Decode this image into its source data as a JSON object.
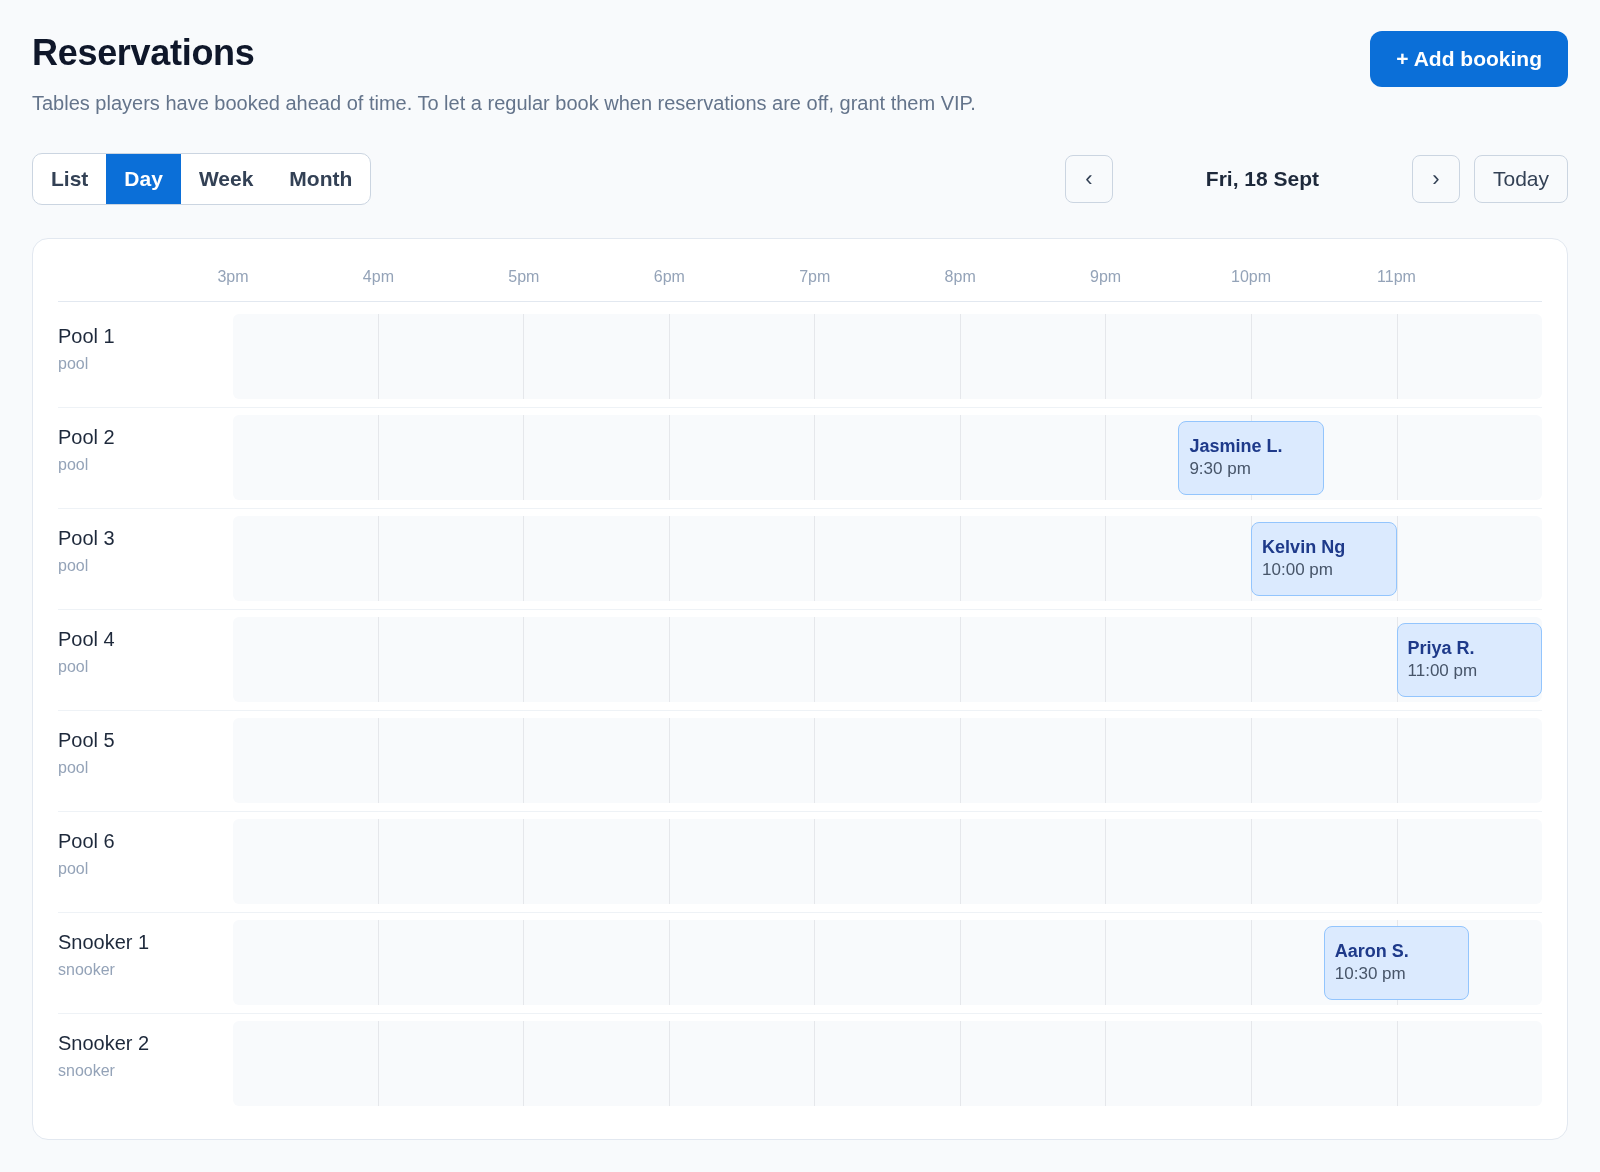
{
  "header": {
    "title": "Reservations",
    "subtitle": "Tables players have booked ahead of time. To let a regular book when reservations are off, grant them VIP.",
    "add_button": "+ Add booking"
  },
  "view_tabs": [
    {
      "label": "List",
      "selected": false
    },
    {
      "label": "Day",
      "selected": true
    },
    {
      "label": "Week",
      "selected": false
    },
    {
      "label": "Month",
      "selected": false
    }
  ],
  "date_nav": {
    "prev": "‹",
    "date": "Fri, 18 Sept",
    "next": "›",
    "today": "Today"
  },
  "schedule": {
    "hours": [
      "3pm",
      "4pm",
      "5pm",
      "6pm",
      "7pm",
      "8pm",
      "9pm",
      "10pm",
      "11pm"
    ],
    "tables": [
      {
        "name": "Pool 1",
        "type": "pool"
      },
      {
        "name": "Pool 2",
        "type": "pool",
        "bookings": [
          {
            "guest": "Jasmine L.",
            "time": "9:30 pm"
          }
        ]
      },
      {
        "name": "Pool 3",
        "type": "pool",
        "bookings": [
          {
            "guest": "Kelvin Ng",
            "time": "10:00 pm"
          }
        ]
      },
      {
        "name": "Pool 4",
        "type": "pool",
        "bookings": [
          {
            "guest": "Priya R.",
            "time": "11:00 pm"
          }
        ]
      },
      {
        "name": "Pool 5",
        "type": "pool"
      },
      {
        "name": "Pool 6",
        "type": "pool"
      },
      {
        "name": "Snooker 1",
        "type": "snooker",
        "bookings": [
          {
            "guest": "Aaron S.",
            "time": "10:30 pm"
          }
        ]
      },
      {
        "name": "Snooker 2",
        "type": "snooker"
      }
    ]
  }
}
